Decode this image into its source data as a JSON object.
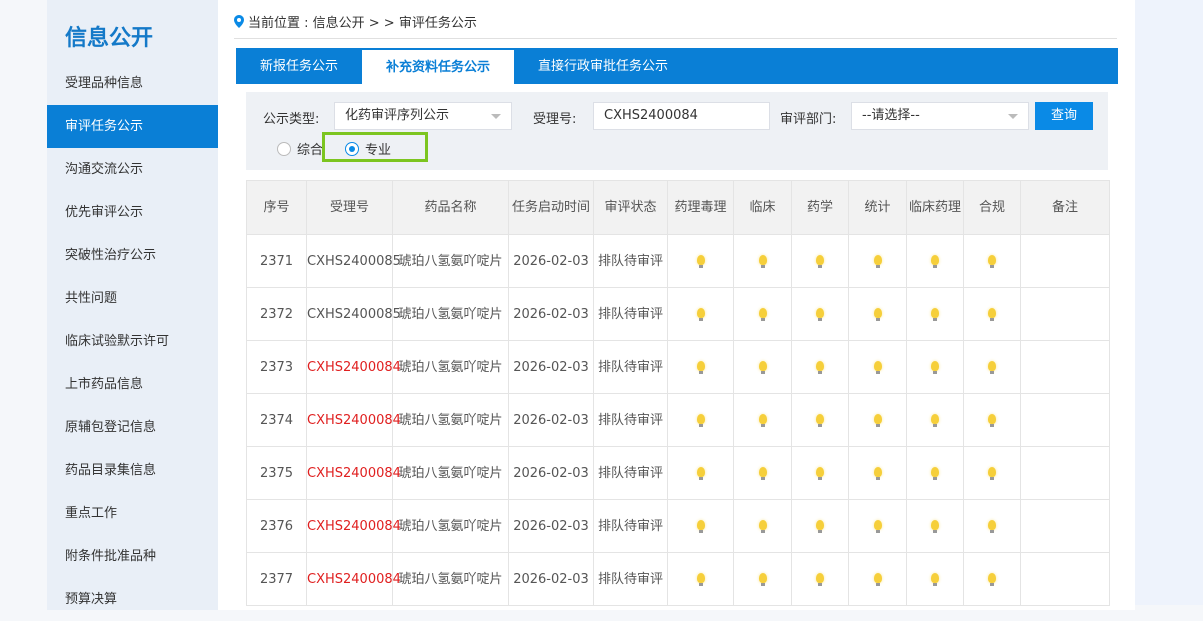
{
  "sidebar": {
    "title": "信息公开",
    "items": [
      "受理品种信息",
      "审评任务公示",
      "沟通交流公示",
      "优先审评公示",
      "突破性治疗公示",
      "共性问题",
      "临床试验默示许可",
      "上市药品信息",
      "原辅包登记信息",
      "药品目录集信息",
      "重点工作",
      "附条件批准品种",
      "预算决算"
    ],
    "active": 1
  },
  "breadcrumb": "当前位置 : 信息公开 > > 审评任务公示",
  "tabs": [
    "新报任务公示",
    "补充资料任务公示",
    "直接行政审批任务公示"
  ],
  "filter": {
    "type_label": "公示类型:",
    "type_value": "化药审评序列公示",
    "acceptance_label": "受理号:",
    "acceptance_value": "CXHS2400084",
    "dept_label": "审评部门:",
    "dept_value": "--请选择--",
    "query_button": "查询",
    "radio_general": "综合",
    "radio_special": "专业"
  },
  "table": {
    "headers": [
      "序号",
      "受理号",
      "药品名称",
      "任务启动时间",
      "审评状态",
      "药理毒理",
      "临床",
      "药学",
      "统计",
      "临床药理",
      "合规",
      "备注"
    ],
    "rows": [
      {
        "no": "2371",
        "id": "CXHS2400085",
        "name": "琥珀八氢氨吖啶片",
        "date": "2026-02-03",
        "status": "排队待审评",
        "red": false
      },
      {
        "no": "2372",
        "id": "CXHS2400085",
        "name": "琥珀八氢氨吖啶片",
        "date": "2026-02-03",
        "status": "排队待审评",
        "red": false
      },
      {
        "no": "2373",
        "id": "CXHS2400084",
        "name": "琥珀八氢氨吖啶片",
        "date": "2026-02-03",
        "status": "排队待审评",
        "red": true
      },
      {
        "no": "2374",
        "id": "CXHS2400084",
        "name": "琥珀八氢氨吖啶片",
        "date": "2026-02-03",
        "status": "排队待审评",
        "red": true
      },
      {
        "no": "2375",
        "id": "CXHS2400084",
        "name": "琥珀八氢氨吖啶片",
        "date": "2026-02-03",
        "status": "排队待审评",
        "red": true
      },
      {
        "no": "2376",
        "id": "CXHS2400084",
        "name": "琥珀八氢氨吖啶片",
        "date": "2026-02-03",
        "status": "排队待审评",
        "red": true
      },
      {
        "no": "2377",
        "id": "CXHS2400084",
        "name": "琥珀八氢氨吖啶片",
        "date": "2026-02-03",
        "status": "排队待审评",
        "red": true
      }
    ]
  }
}
